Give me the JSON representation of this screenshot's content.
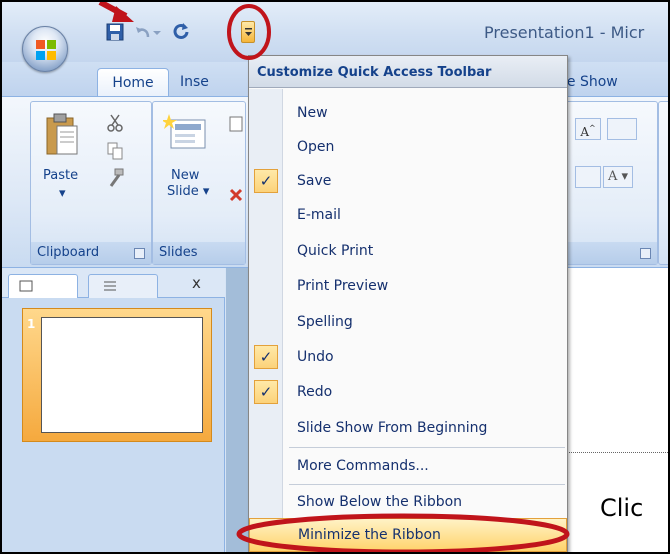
{
  "window": {
    "title": "Presentation1 - Micr"
  },
  "qat": {
    "save_icon": "save-icon",
    "undo_icon": "undo-icon",
    "redo_icon": "redo-icon",
    "customize_icon": "customize-qat-icon"
  },
  "tabs": [
    "Home",
    "Inse",
    "de Show"
  ],
  "ribbon": {
    "groups": {
      "clipboard": "Clipboard",
      "slides": "Slides"
    },
    "paste_label": "Paste",
    "new_slide_label_1": "New",
    "new_slide_label_2": "Slide ▾"
  },
  "slide_panel": {
    "close": "x",
    "slide_number": "1"
  },
  "menu": {
    "header": "Customize Quick Access Toolbar",
    "items": [
      {
        "label": "New",
        "checked": false
      },
      {
        "label": "Open",
        "checked": false
      },
      {
        "label": "Save",
        "checked": true
      },
      {
        "label": "E-mail",
        "checked": false
      },
      {
        "label": "Quick Print",
        "checked": false
      },
      {
        "label": "Print Preview",
        "checked": false
      },
      {
        "label": "Spelling",
        "checked": false
      },
      {
        "label": "Undo",
        "checked": true
      },
      {
        "label": "Redo",
        "checked": true
      },
      {
        "label": "Slide Show From Beginning",
        "checked": false
      },
      {
        "label": "More Commands...",
        "checked": false
      },
      {
        "label": "Show Below the Ribbon",
        "checked": false
      },
      {
        "label": "Minimize the Ribbon",
        "checked": false
      }
    ],
    "check_mark": "✓"
  },
  "canvas": {
    "placeholder_text": "Clic"
  },
  "colors": {
    "annotation": "#c0141b",
    "highlight": "#ffd36b"
  }
}
